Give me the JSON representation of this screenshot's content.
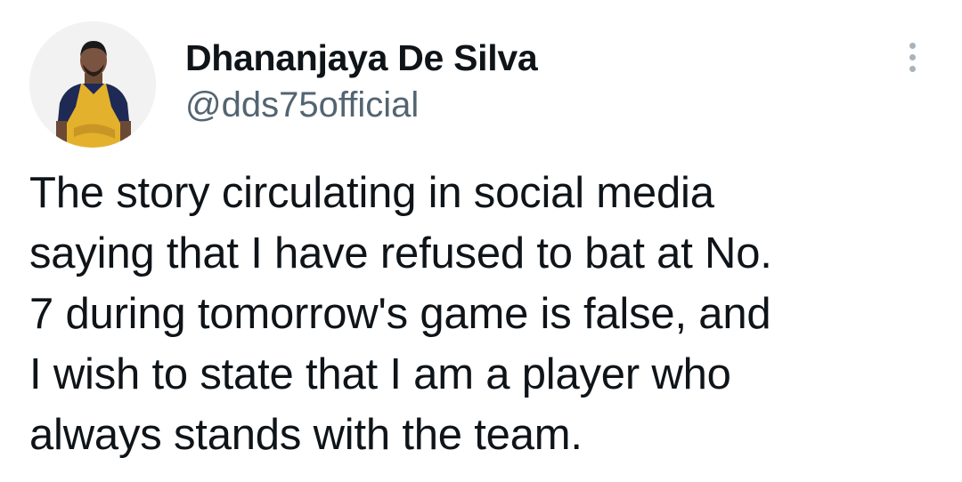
{
  "author": {
    "name": "Dhananjaya De Silva",
    "handle": "@dds75official",
    "avatar_icon": "profile-photo-avatar"
  },
  "menu": {
    "icon": "more-vertical-icon"
  },
  "tweet": {
    "text": "The story circulating in social media\nsaying that I have refused to bat at No.\n7 during tomorrow's game is false, and\nI wish to state that I am a player who\nalways stands with the team."
  },
  "colors": {
    "text": "#0f1419",
    "secondary": "#536471",
    "menu_dots": "#a9b3bc",
    "jersey_yellow": "#e4b12c",
    "jersey_navy": "#1e2a55"
  }
}
